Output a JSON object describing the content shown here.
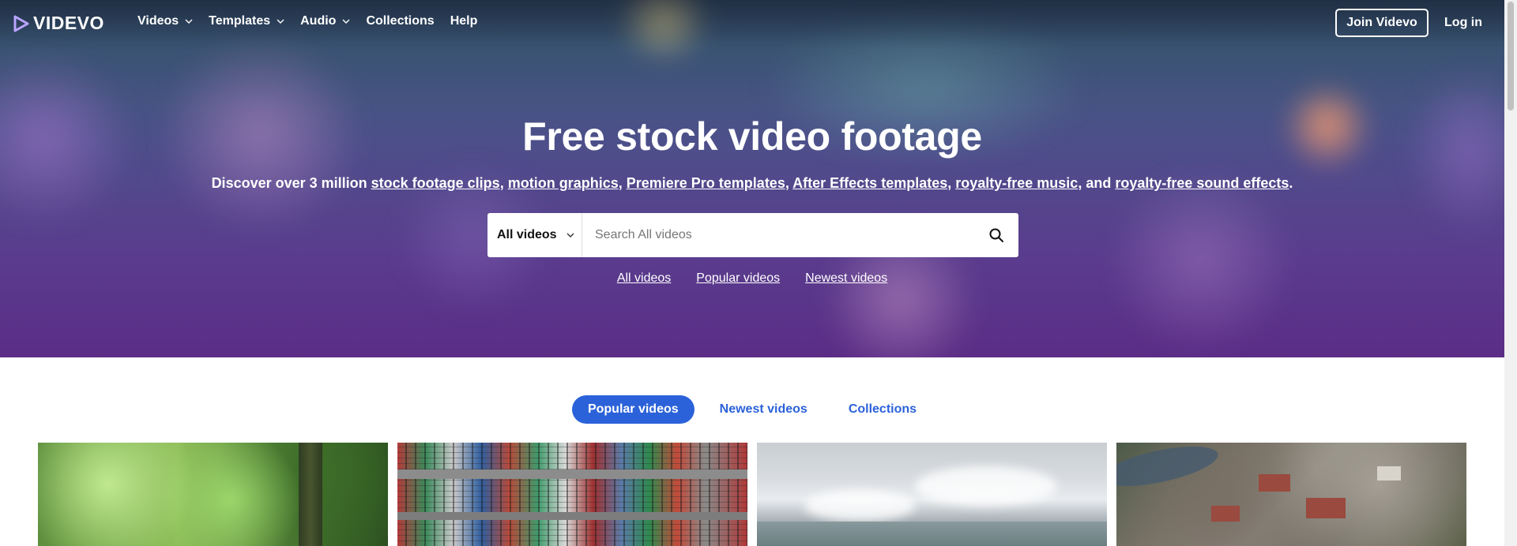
{
  "brand": {
    "name": "VIDEVO"
  },
  "nav": {
    "items": [
      {
        "label": "Videos",
        "has_dropdown": true
      },
      {
        "label": "Templates",
        "has_dropdown": true
      },
      {
        "label": "Audio",
        "has_dropdown": true
      },
      {
        "label": "Collections",
        "has_dropdown": false
      },
      {
        "label": "Help",
        "has_dropdown": false
      }
    ],
    "join_label": "Join Videvo",
    "login_label": "Log in"
  },
  "hero": {
    "title": "Free stock video footage",
    "subtitle": {
      "prefix": "Discover over 3 million ",
      "links": [
        "stock footage clips",
        "motion graphics",
        "Premiere Pro templates",
        "After Effects templates",
        "royalty-free music",
        "royalty-free sound effects"
      ],
      "sep": ", ",
      "and": ", and ",
      "suffix": "."
    },
    "search": {
      "category": "All videos",
      "placeholder": "Search All videos"
    },
    "quick_links": [
      "All videos",
      "Popular videos",
      "Newest videos"
    ]
  },
  "tabs": [
    {
      "label": "Popular videos",
      "active": true
    },
    {
      "label": "Newest videos",
      "active": false
    },
    {
      "label": "Collections",
      "active": false
    }
  ],
  "colors": {
    "accent": "#2b62d9",
    "hero_top": "#2f4a66",
    "hero_bottom": "#5b2d86"
  },
  "icons": {
    "logo": "videvo-play-icon",
    "dropdown": "chevron-down-icon",
    "search": "search-icon"
  }
}
